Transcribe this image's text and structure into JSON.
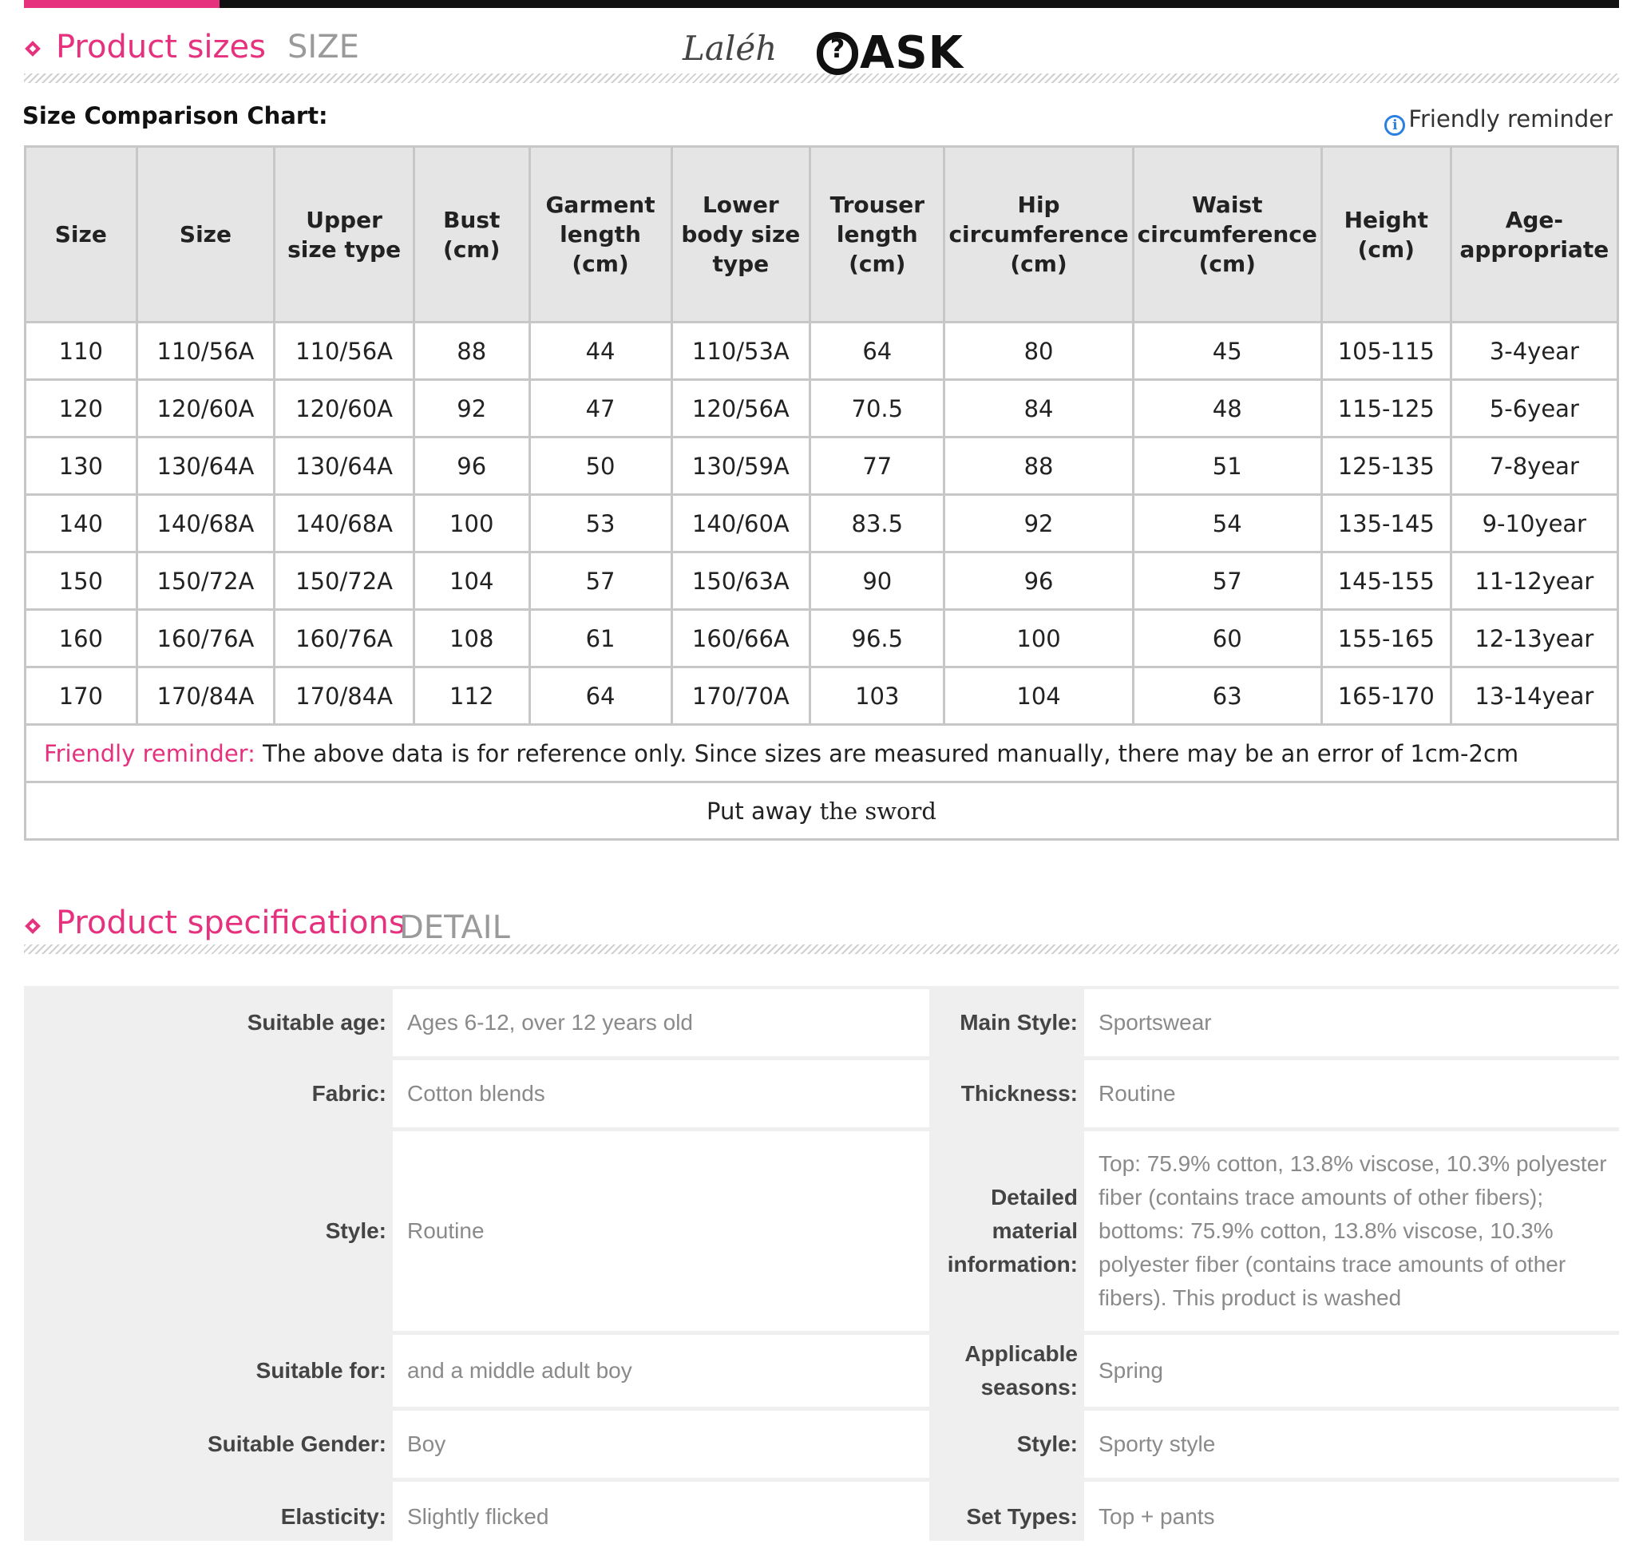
{
  "sections": {
    "sizes": {
      "title": "Product sizes",
      "title_en": "SIZE"
    },
    "specs": {
      "title": "Product specifications",
      "title_en": "DETAIL"
    }
  },
  "logo": {
    "script_text": "Laléh",
    "brand": "ASK",
    "icon_glyph": "?"
  },
  "chart_label": "Size Comparison Chart:",
  "reminder_label": "Friendly reminder",
  "size_table": {
    "headers": [
      "Size",
      "Size",
      "Upper size type",
      "Bust (cm)",
      "Garment length (cm)",
      "Lower body size type",
      "Trouser length (cm)",
      "Hip circumference (cm)",
      "Waist circumference (cm)",
      "Height (cm)",
      "Age-appropriate"
    ],
    "rows": [
      [
        "110",
        "110/56A",
        "110/56A",
        "88",
        "44",
        "110/53A",
        "64",
        "80",
        "45",
        "105-115",
        "3-4year"
      ],
      [
        "120",
        "120/60A",
        "120/60A",
        "92",
        "47",
        "120/56A",
        "70.5",
        "84",
        "48",
        "115-125",
        "5-6year"
      ],
      [
        "130",
        "130/64A",
        "130/64A",
        "96",
        "50",
        "130/59A",
        "77",
        "88",
        "51",
        "125-135",
        "7-8year"
      ],
      [
        "140",
        "140/68A",
        "140/68A",
        "100",
        "53",
        "140/60A",
        "83.5",
        "92",
        "54",
        "135-145",
        "9-10year"
      ],
      [
        "150",
        "150/72A",
        "150/72A",
        "104",
        "57",
        "150/63A",
        "90",
        "96",
        "57",
        "145-155",
        "11-12year"
      ],
      [
        "160",
        "160/76A",
        "160/76A",
        "108",
        "61",
        "160/66A",
        "96.5",
        "100",
        "60",
        "155-165",
        "12-13year"
      ],
      [
        "170",
        "170/84A",
        "170/84A",
        "112",
        "64",
        "170/70A",
        "103",
        "104",
        "63",
        "165-170",
        "13-14year"
      ]
    ],
    "note_label": "Friendly reminder:",
    "note_text": " The above data is for reference only. Since sizes are measured manually, there may be an error of 1cm-2cm",
    "footer_a": "Put away ",
    "footer_b": "the  sword"
  },
  "specs": [
    {
      "label": "Suitable age:",
      "value": "Ages 6-12, over 12 years old"
    },
    {
      "label": "Main Style:",
      "value": "Sportswear"
    },
    {
      "label": "Fabric:",
      "value": "Cotton blends"
    },
    {
      "label": "Thickness:",
      "value": "Routine"
    },
    {
      "label": "Style:",
      "value": "Routine"
    },
    {
      "label": "Detailed material information:",
      "value": "Top: 75.9% cotton, 13.8% viscose, 10.3% polyester fiber (contains trace amounts of other fibers); bottoms: 75.9% cotton, 13.8% viscose, 10.3% polyester fiber (contains trace amounts of other fibers). This product is washed"
    },
    {
      "label": "Suitable for:",
      "value": "and a middle adult boy"
    },
    {
      "label": "Applicable seasons:",
      "value": "Spring"
    },
    {
      "label": "Suitable Gender:",
      "value": "Boy"
    },
    {
      "label": "Style:",
      "value": "Sporty style"
    },
    {
      "label": "Elasticity:",
      "value": "Slightly flicked"
    },
    {
      "label": "Set Types:",
      "value": "Top + pants"
    }
  ],
  "colors": {
    "accent": "#e6317e",
    "info": "#2a7fe0",
    "header_bg": "#e5e5e5",
    "border": "#c7c7c7"
  }
}
